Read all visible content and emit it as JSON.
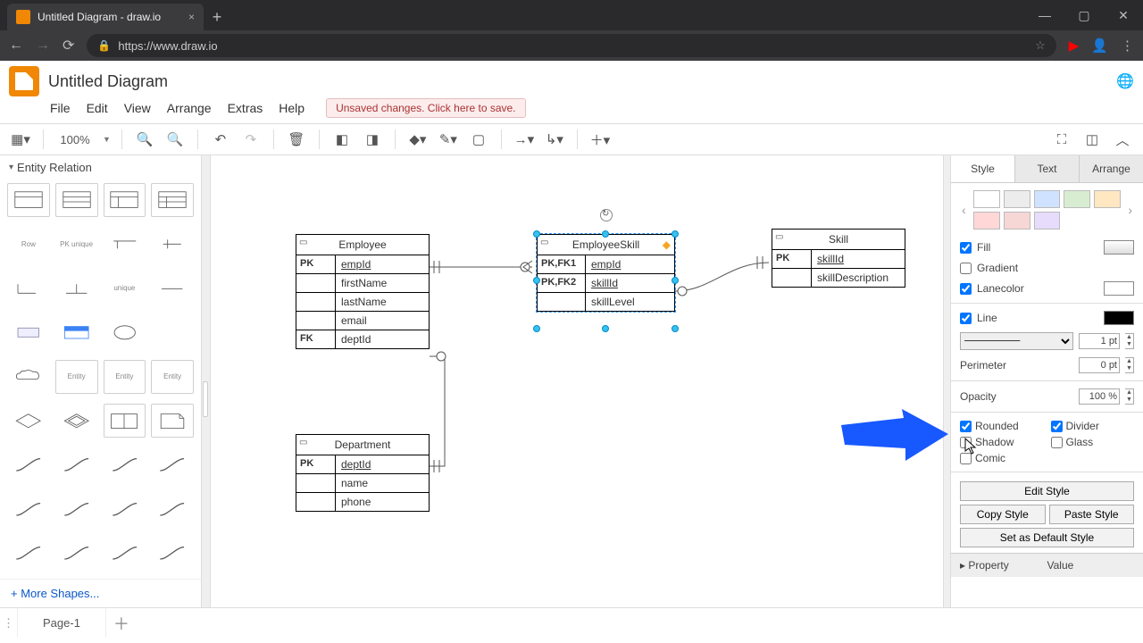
{
  "browser": {
    "tab_title": "Untitled Diagram - draw.io",
    "url": "https://www.draw.io"
  },
  "app": {
    "title": "Untitled Diagram",
    "menu": [
      "File",
      "Edit",
      "View",
      "Arrange",
      "Extras",
      "Help"
    ],
    "save_warning": "Unsaved changes. Click here to save."
  },
  "toolbar": {
    "zoom": "100%"
  },
  "sidebar": {
    "section": "Entity Relation",
    "more_shapes": "+ More Shapes..."
  },
  "canvas": {
    "tables": {
      "employee": {
        "title": "Employee",
        "rows": [
          {
            "k": "PK",
            "v": "empId",
            "u": true
          },
          {
            "k": "",
            "v": "firstName"
          },
          {
            "k": "",
            "v": "lastName"
          },
          {
            "k": "",
            "v": "email"
          },
          {
            "k": "FK",
            "v": "deptId"
          }
        ]
      },
      "employeeSkill": {
        "title": "EmployeeSkill",
        "rows": [
          {
            "k": "PK,FK1",
            "v": "empId",
            "u": true
          },
          {
            "k": "PK,FK2",
            "v": "skillId",
            "u": true
          },
          {
            "k": "",
            "v": "skillLevel"
          }
        ]
      },
      "skill": {
        "title": "Skill",
        "rows": [
          {
            "k": "PK",
            "v": "skillId",
            "u": true
          },
          {
            "k": "",
            "v": "skillDescription"
          }
        ]
      },
      "department": {
        "title": "Department",
        "rows": [
          {
            "k": "PK",
            "v": "deptId",
            "u": true
          },
          {
            "k": "",
            "v": "name"
          },
          {
            "k": "",
            "v": "phone"
          }
        ]
      }
    }
  },
  "format": {
    "tabs": [
      "Style",
      "Text",
      "Arrange"
    ],
    "swatch_colors": [
      "#ffffff",
      "#ececec",
      "#cfe2ff",
      "#d8ecd2",
      "#ffe7c2",
      "#ffd7d7",
      "#f7d6d6",
      "#e7dcfb"
    ],
    "fill_label": "Fill",
    "gradient_label": "Gradient",
    "lanecolor_label": "Lanecolor",
    "line_label": "Line",
    "line_width": "1 pt",
    "perimeter_label": "Perimeter",
    "perimeter_value": "0 pt",
    "opacity_label": "Opacity",
    "opacity_value": "100 %",
    "flags": {
      "rounded": "Rounded",
      "divider": "Divider",
      "shadow": "Shadow",
      "glass": "Glass",
      "comic": "Comic"
    },
    "edit_style": "Edit Style",
    "copy_style": "Copy Style",
    "paste_style": "Paste Style",
    "default_style": "Set as Default Style",
    "property": "Property",
    "value": "Value"
  },
  "pages": {
    "page1": "Page-1"
  }
}
